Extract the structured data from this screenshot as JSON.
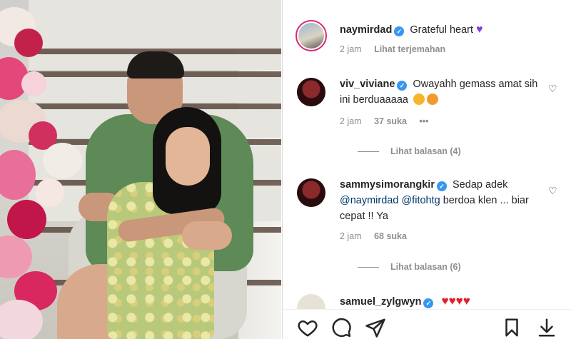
{
  "caption": {
    "username": "naymirdad",
    "text": "Grateful heart",
    "time": "2 jam",
    "translate": "Lihat terjemahan"
  },
  "comments": [
    {
      "username": "viv_viviane",
      "text": "Owayahh gemass amat sih ini berduaaaaa",
      "time": "2 jam",
      "likes": "37 suka",
      "more": "•••",
      "replies": "Lihat balasan (4)"
    },
    {
      "username": "sammysimorangkir",
      "text_start": "Sedap adek",
      "mention1": "@naymirdad",
      "mention2": "@fitohtg",
      "text_end": "berdoa klen ... biar cepat !! Ya",
      "time": "2 jam",
      "likes": "68 suka",
      "replies": "Lihat balasan (6)"
    },
    {
      "username": "samuel_zylgwyn",
      "hearts": "♥♥♥♥"
    }
  ],
  "icons": {
    "like": "heart-outline-icon",
    "comment": "comment-bubble-icon",
    "share": "paper-plane-icon",
    "save": "bookmark-icon",
    "download": "download-icon"
  },
  "colors": {
    "verified": "#3897f0",
    "mention": "#00376b",
    "meta": "#8e8e8e",
    "heart": "#e0202a",
    "purple_heart": "#7b3fe4"
  }
}
